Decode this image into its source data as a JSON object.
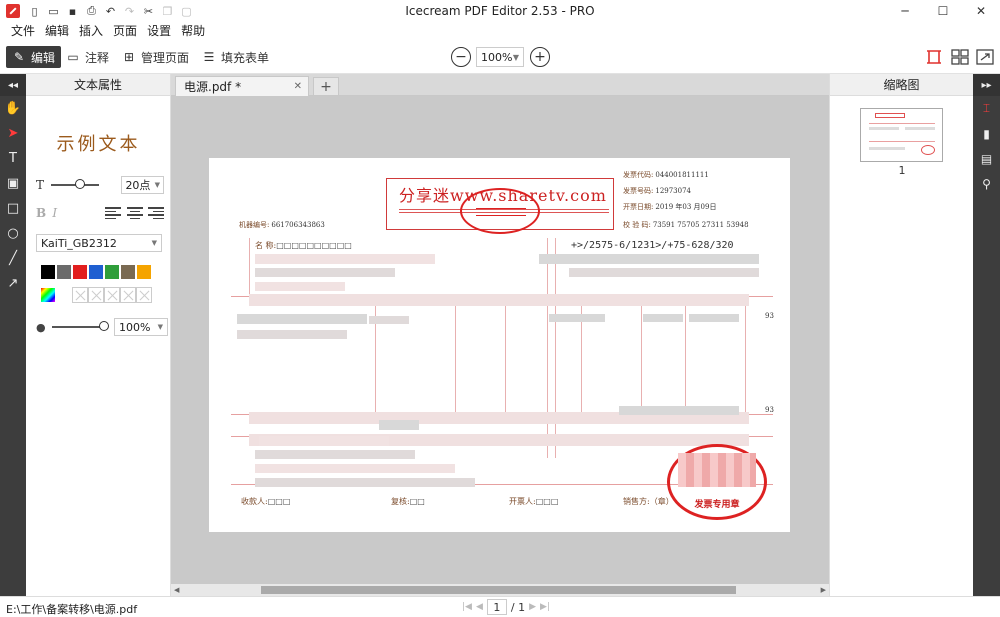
{
  "window": {
    "title": "Icecream PDF Editor 2.53 - PRO"
  },
  "menu": [
    "文件",
    "编辑",
    "插入",
    "页面",
    "设置",
    "帮助"
  ],
  "toolbar": {
    "modes": [
      {
        "label": "编辑",
        "icon": "pencil-icon",
        "active": true
      },
      {
        "label": "注释",
        "icon": "comment-icon",
        "active": false
      },
      {
        "label": "管理页面",
        "icon": "pages-icon",
        "active": false
      },
      {
        "label": "填充表单",
        "icon": "form-icon",
        "active": false
      }
    ],
    "zoom": "100%"
  },
  "properties": {
    "header": "文本属性",
    "sample": "示例文本",
    "font_size": "20点",
    "font_name": "KaiTi_GB2312",
    "colors": [
      "#000000",
      "#6b6b6b",
      "#e21f1f",
      "#1f5fd1",
      "#2f9e3b",
      "#7a6a52",
      "#f5a400"
    ],
    "opacity": "100%"
  },
  "document": {
    "tab_label": "电源.pdf *",
    "stamp_title": "分享迷www.sharetv.com",
    "machine_no_label": "机器编号:",
    "machine_no": "661706343863",
    "invoice_code_label": "发票代码:",
    "invoice_code": "044001811111",
    "invoice_no_label": "发票号码:",
    "invoice_no": "12973074",
    "issue_date_label": "开票日期:",
    "issue_date": "2019 年03 月09日",
    "check_code_label": "校 验 码:",
    "check_code": "73591 75705 27311 53948",
    "name_label": "名     称:",
    "name_value": "□□□□□□□□□□",
    "code_line": "+>/2575-6/1231>/+75-628/320",
    "side_num_1": "93",
    "side_num_2": "93",
    "payee_label": "收款人:",
    "payee_value": "□□□",
    "reviewer_label": "复核:",
    "reviewer_value": "□□",
    "drawer_label": "开票人:",
    "drawer_value": "□□□",
    "seller_label": "销售方:（章）",
    "seal_text": "发票专用章"
  },
  "thumbnails": {
    "header": "缩略图",
    "page_number": "1"
  },
  "status": {
    "path": "E:\\工作\\备案转移\\电源.pdf",
    "current_page": "1",
    "total_pages": "/ 1"
  }
}
